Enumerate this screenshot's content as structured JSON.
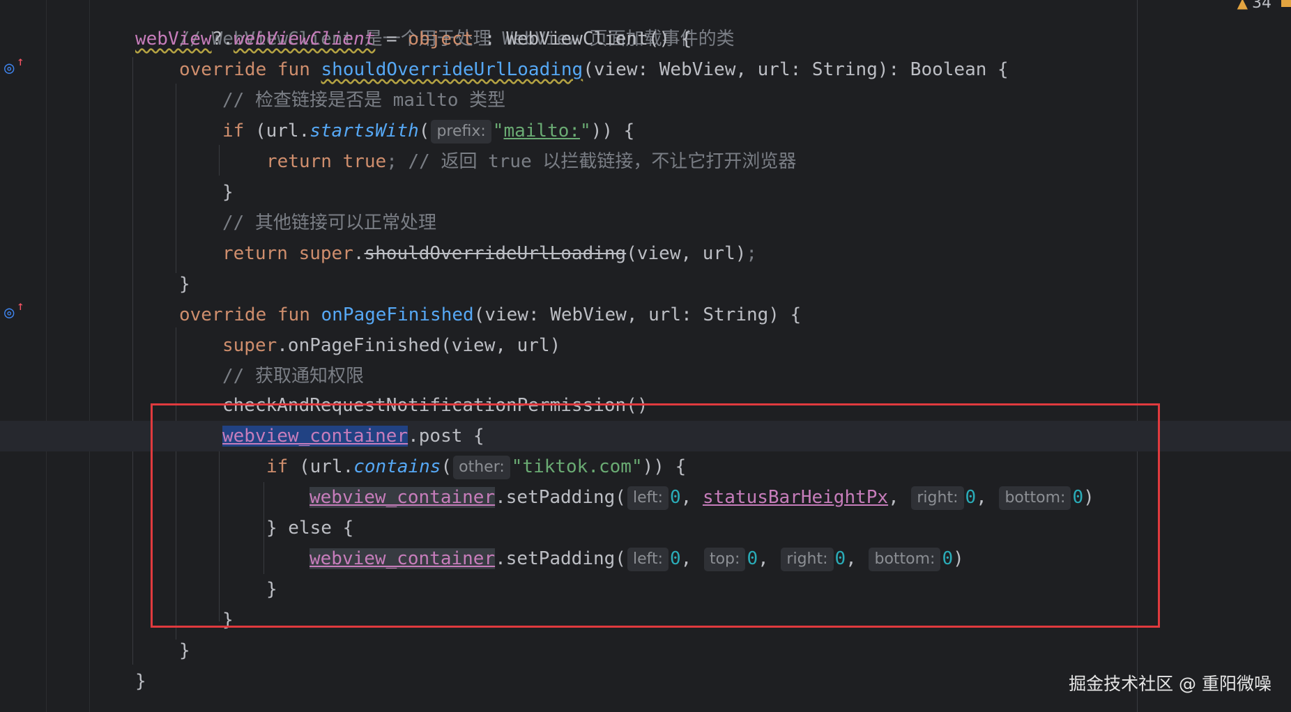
{
  "editor": {
    "status": {
      "warning_count": "34"
    },
    "watermark": "掘金技术社区 @ 重阳微噪",
    "inlay_hints": {
      "prefix": "prefix:",
      "other": "other:",
      "left": "left:",
      "top": "top:",
      "right": "right:",
      "bottom": "bottom:"
    },
    "code": {
      "l0_comment": "// WebViewClient 是一个用于处理 WebView 页面加载事件的类",
      "l1_webview": "webView",
      "l1_safe": "?.",
      "l1_client": "webViewClient",
      "l1_eq": " = ",
      "l1_object": "object",
      "l1_rest": " : WebViewClient() {",
      "override": "override",
      "fun": "fun",
      "l2_name": "shouldOverrideUrlLoading",
      "l2_params": "(view: WebView, url: String): Boolean {",
      "l3_comment": "// 检查链接是否是 mailto 类型",
      "if": "if",
      "l4_open": " (url.",
      "l4_starts": "startsWith",
      "paren_open": "(",
      "quote": "\"",
      "l4_mailto": "mailto:",
      "l4_close": ")) {",
      "return": "return",
      "true": "true",
      "semicolon": ";",
      "l5_comment": " // 返回 true 以拦截链接，不让它打开浏览器",
      "brace_close": "}",
      "l7_comment": "// 其他链接可以正常处理",
      "super": "super",
      "dot": ".",
      "l8_deprecated": "shouldOverrideUrlLoading",
      "l8_args": "(view, url)",
      "l10_name": "onPageFinished",
      "l10_params": "(view: WebView, url: String) {",
      "l11_rest": ".onPageFinished(view, url)",
      "l12_comment": "// 获取通知权限",
      "l13_call": "checkAndRequestNotificationPermission()",
      "container": "webview_container",
      "l14_rest": ".post {",
      "l15_open": " (url.",
      "l15_contains": "contains",
      "l15_string": "\"tiktok.com\"",
      "set_padding": ".setPadding(",
      "zero": "0",
      "comma": ", ",
      "status_bar": "statusBarHeightPx",
      "close_paren": ")",
      "l17_else": "} else {"
    }
  }
}
